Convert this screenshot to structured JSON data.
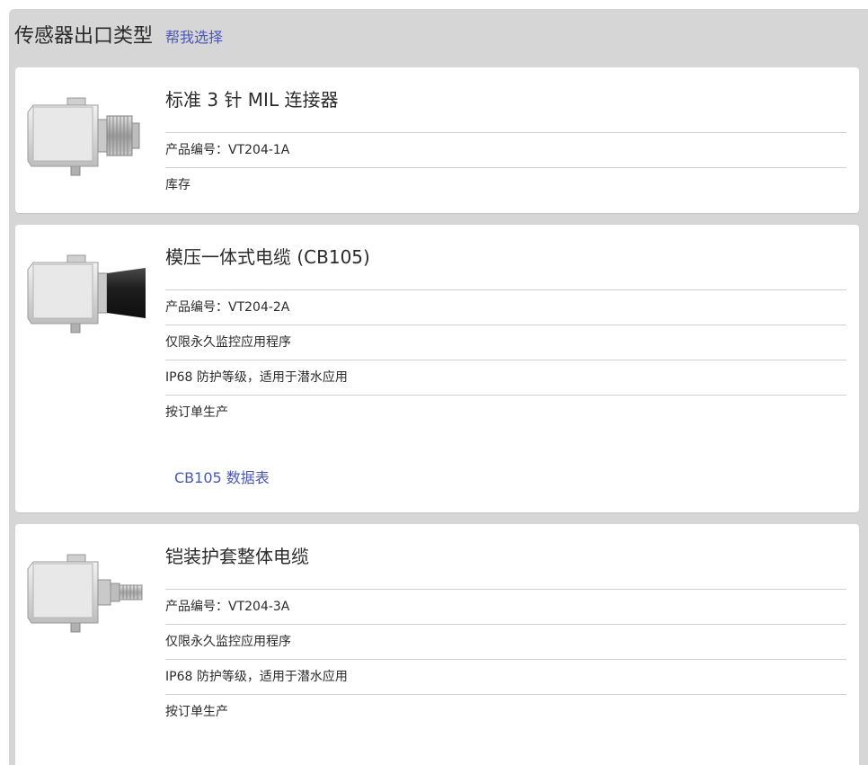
{
  "header": {
    "title": "传感器出口类型",
    "help_link": "帮我选择"
  },
  "cards": [
    {
      "title": "标准 3 针 MIL 连接器",
      "rows": [
        "产品编号：VT204-1A",
        "库存"
      ],
      "image_icon": "mil-connector-sensor-icon"
    },
    {
      "title": "模压一体式电缆 (CB105)",
      "rows": [
        "产品编号：VT204-2A",
        "仅限永久监控应用程序",
        "IP68 防护等级，适用于潜水应用",
        "按订单生产"
      ],
      "link": "CB105 数据表",
      "image_icon": "molded-cable-sensor-icon"
    },
    {
      "title": "铠装护套整体电缆",
      "rows": [
        "产品编号：VT204-3A",
        "仅限永久监控应用程序",
        "IP68 防护等级，适用于潜水应用",
        "按订单生产"
      ],
      "image_icon": "armored-cable-sensor-icon"
    }
  ],
  "colors": {
    "panel_bg": "#d6d6d6",
    "link": "#4a57b8",
    "text": "#2b2b2b",
    "divider": "#cfcfcf"
  }
}
